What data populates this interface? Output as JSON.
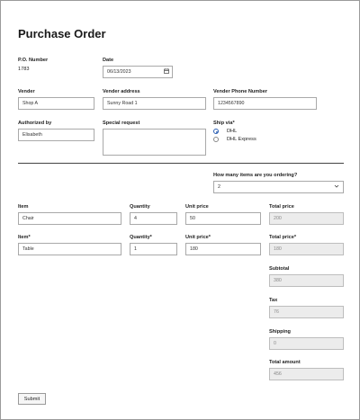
{
  "form": {
    "title": "Purchase Order",
    "po_number": {
      "label": "P.O. Number",
      "value": "1783"
    },
    "date": {
      "label": "Date",
      "value": "06/13/2023"
    },
    "vendor": {
      "label": "Vender",
      "value": "Shop A"
    },
    "vendor_address": {
      "label": "Vender address",
      "value": "Sunny Road 1"
    },
    "vendor_phone": {
      "label": "Vender Phone Number",
      "value": "1234567890"
    },
    "authorized_by": {
      "label": "Authorized by",
      "value": "Elisabeth"
    },
    "special_request": {
      "label": "Special request",
      "value": ""
    },
    "ship_via": {
      "label": "Ship via*",
      "options": [
        "DHL",
        "DHL Express"
      ],
      "selected": "DHL"
    },
    "items_count": {
      "label": "How many items are you ordering?",
      "value": "2"
    },
    "items": [
      {
        "item_label": "Item",
        "item": "Chair",
        "qty_label": "Quantity",
        "qty": "4",
        "price_label": "Unit price",
        "price": "50",
        "total_label": "Total price",
        "total": "200"
      },
      {
        "item_label": "Item*",
        "item": "Table",
        "qty_label": "Quantity*",
        "qty": "1",
        "price_label": "Unit price*",
        "price": "180",
        "total_label": "Total price*",
        "total": "180"
      }
    ],
    "subtotal": {
      "label": "Subtotal",
      "value": "380"
    },
    "tax": {
      "label": "Tax",
      "value": "76"
    },
    "shipping": {
      "label": "Shipping",
      "value": "0"
    },
    "total_amount": {
      "label": "Total amount",
      "value": "456"
    },
    "submit_label": "Submit"
  },
  "icons": {
    "calendar": "calendar-icon",
    "dropdown": "chevron-down-icon"
  }
}
